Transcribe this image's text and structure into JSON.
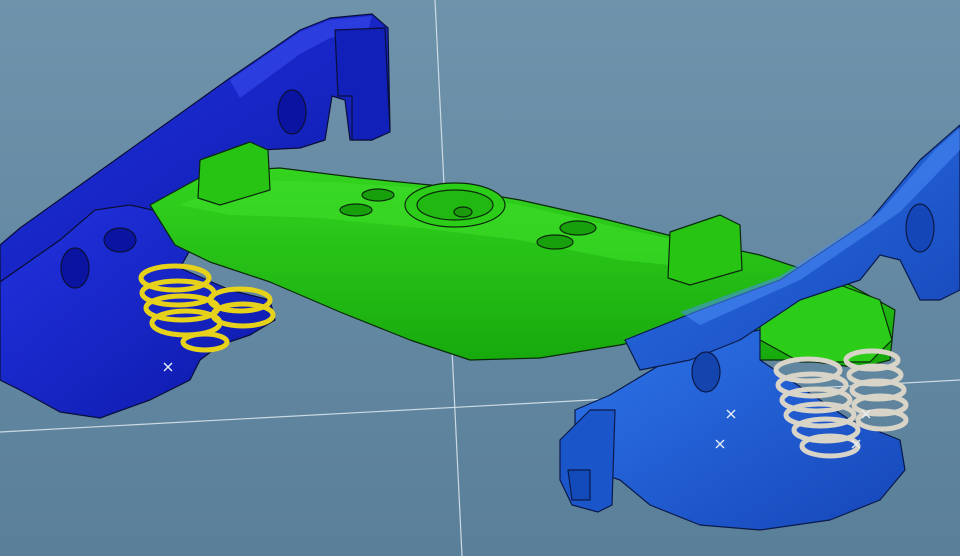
{
  "viewport": {
    "background_top": "#6f93ab",
    "background_bottom": "#5a7f99",
    "axis_color": "#d8e4ec"
  },
  "model": {
    "left_sideframe_color": "#1424c8",
    "right_sideframe_color": "#1f5fd6",
    "bolster_color": "#1fbf12",
    "left_springs_color": "#e6d21a",
    "right_springs_color": "#d8d4c8",
    "edge_color": "#0a0f3a"
  }
}
